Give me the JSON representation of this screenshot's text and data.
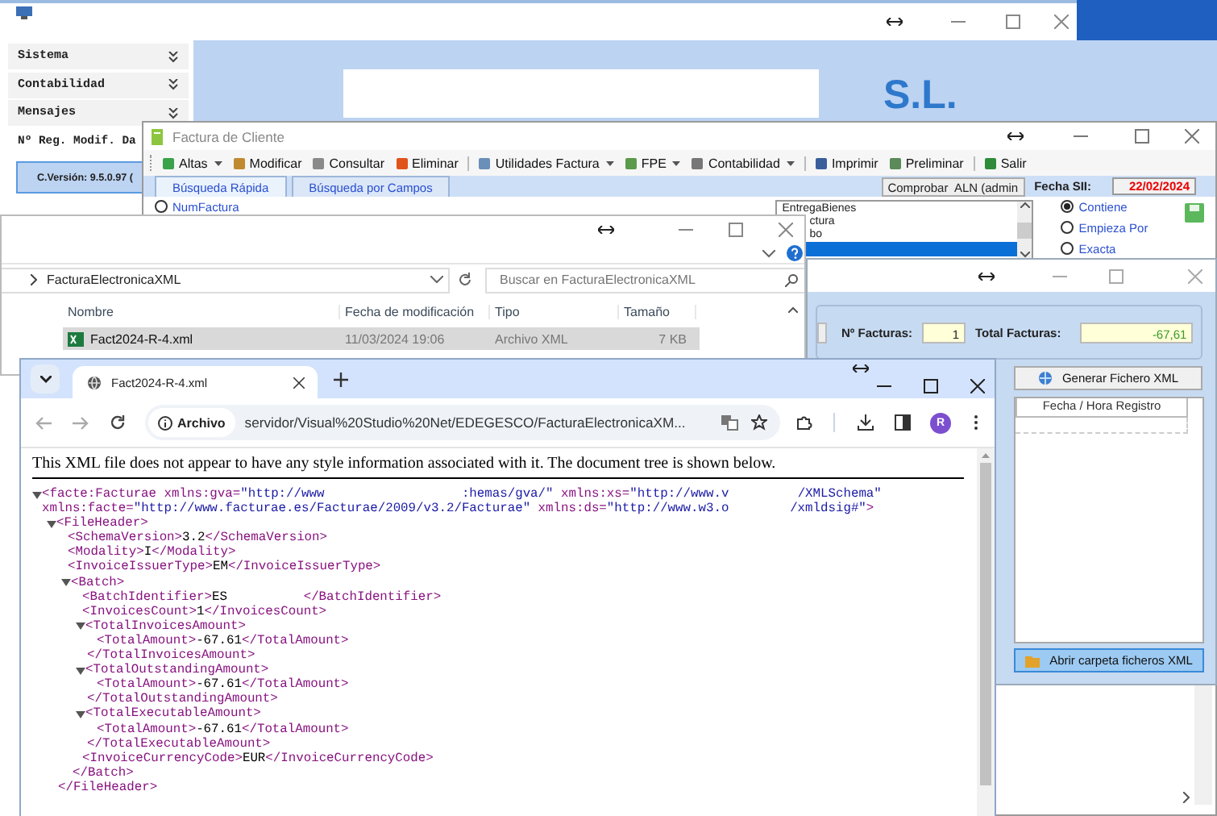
{
  "main_window": {
    "menu": [
      {
        "label": "Sistema",
        "kind": "group"
      },
      {
        "label": "Contabilidad",
        "kind": "group"
      },
      {
        "label": "Mensajes",
        "kind": "group"
      },
      {
        "label": "Nº Reg. Modif. Da",
        "kind": "entry"
      }
    ],
    "company": "S.L.",
    "version": "C.Versión: 9.5.0.97 ("
  },
  "factura_window": {
    "title": "Factura de Cliente",
    "toolbar": [
      {
        "label": "Altas",
        "dropdown": true,
        "separator_before": false
      },
      {
        "label": "Modificar",
        "dropdown": false,
        "separator_before": false
      },
      {
        "label": "Consultar",
        "dropdown": false,
        "separator_before": false
      },
      {
        "label": "Eliminar",
        "dropdown": false,
        "separator_before": false
      },
      {
        "label": "Utilidades Factura",
        "dropdown": true,
        "separator_before": true
      },
      {
        "label": "FPE",
        "dropdown": true,
        "separator_before": false
      },
      {
        "label": "Contabilidad",
        "dropdown": true,
        "separator_before": false
      },
      {
        "label": "Imprimir",
        "dropdown": false,
        "separator_before": true
      },
      {
        "label": "Preliminar",
        "dropdown": false,
        "separator_before": false
      },
      {
        "label": "Salir",
        "dropdown": false,
        "separator_before": true
      }
    ],
    "tabs": [
      {
        "label": "Búsqueda Rápida",
        "selected": true
      },
      {
        "label": "Búsqueda por Campos",
        "selected": false
      }
    ],
    "user": "Comprobar  ALN (admin",
    "date_label": "Fecha SII:",
    "date": "22/02/2024",
    "field_option": {
      "label": "NumFactura",
      "selected": false
    },
    "fields_list": [
      {
        "label": "EntregaBienes",
        "selected": false
      },
      {
        "label": "ctura",
        "selected": false
      },
      {
        "label": "bo",
        "selected": false
      },
      {
        "selected": true
      }
    ],
    "match_options": [
      {
        "label": "Contiene",
        "selected": true
      },
      {
        "label": "Empieza Por",
        "selected": false
      },
      {
        "label": "Exacta",
        "selected": false
      }
    ]
  },
  "explorer": {
    "folder": "FacturaElectronicaXML",
    "search_placeholder": "Buscar en FacturaElectronicaXML",
    "columns": [
      "Nombre",
      "Fecha de modificación",
      "Tipo",
      "Tamaño"
    ],
    "rows": [
      {
        "cells": [
          "Fact2024-R-4.xml",
          "11/03/2024 19:06",
          "Archivo XML",
          "7 KB"
        ],
        "selected": true
      }
    ]
  },
  "invoices_window": {
    "count_label": "Nº Facturas:",
    "count": "1",
    "total_label": "Total Facturas:",
    "total": "-67,61",
    "generate_button": "Generar Fichero XML",
    "columns": [
      "Fecha / Hora Registro"
    ],
    "open_folder_button": "Abrir carpeta ficheros XML"
  },
  "browser": {
    "tabs": [
      {
        "title": "Fact2024-R-4.xml",
        "selected": true
      }
    ],
    "scheme_chip": "Archivo",
    "url": "servidor/Visual%20Studio%20Net/EDEGESCO/FacturaElectronicaXM...",
    "avatar": "R",
    "notice": "This XML file does not appear to have any style information associated with it. The document tree is shown below.",
    "xml": [
      {
        "open": "<facte:Facturae xmlns:gva=\"http://www                  :hemas/gva/\" xmlns:xs=\"http://www.v         /XMLSchema\"\nxmlns:facte=\"http://www.facturae.es/Facturae/2009/v3.2/Facturae\" xmlns:ds=\"http://www.w3.o        /xmldsig#\">",
        "expanded": true,
        "children": [
          {
            "open": "<FileHeader>",
            "expanded": true,
            "close": "</FileHeader>",
            "children": [
              {
                "text": "<SchemaVersion>3.2</SchemaVersion>"
              },
              {
                "text": "<Modality>I</Modality>"
              },
              {
                "text": "<InvoiceIssuerType>EM</InvoiceIssuerType>"
              },
              {
                "open": "<Batch>",
                "expanded": true,
                "close": "</Batch>",
                "children": [
                  {
                    "text": "<BatchIdentifier>ES          </BatchIdentifier>"
                  },
                  {
                    "text": "<InvoicesCount>1</InvoicesCount>"
                  },
                  {
                    "open": "<TotalInvoicesAmount>",
                    "expanded": true,
                    "close": "</TotalInvoicesAmount>",
                    "children": [
                      {
                        "text": "<TotalAmount>-67.61</TotalAmount>"
                      }
                    ]
                  },
                  {
                    "open": "<TotalOutstandingAmount>",
                    "expanded": true,
                    "close": "</TotalOutstandingAmount>",
                    "children": [
                      {
                        "text": "<TotalAmount>-67.61</TotalAmount>"
                      }
                    ]
                  },
                  {
                    "open": "<TotalExecutableAmount>",
                    "expanded": true,
                    "close": "</TotalExecutableAmount>",
                    "children": [
                      {
                        "text": "<TotalAmount>-67.61</TotalAmount>"
                      }
                    ]
                  },
                  {
                    "text": "<InvoiceCurrencyCode>EUR</InvoiceCurrencyCode>"
                  }
                ]
              }
            ]
          }
        ]
      }
    ]
  }
}
